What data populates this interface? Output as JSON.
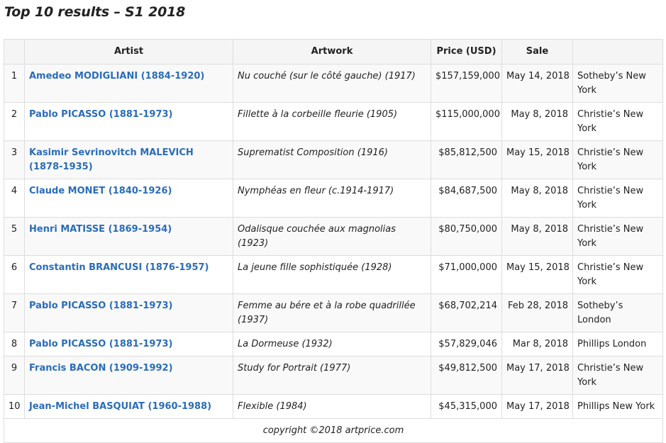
{
  "title": "Top 10 results – S1 2018",
  "table": {
    "headers": [
      "",
      "Artist",
      "Artwork",
      "Price (USD)",
      "Sale",
      ""
    ],
    "rows": [
      {
        "rank": "1",
        "artist": "Amedeo MODIGLIANI (1884-1920)",
        "artwork": "Nu couché (sur le côté gauche) (1917)",
        "price": "$157,159,000",
        "sale": "May 14, 2018",
        "house": "Sotheby’s New York"
      },
      {
        "rank": "2",
        "artist": "Pablo PICASSO (1881-1973)",
        "artwork": "Fillette à la corbeille fleurie (1905)",
        "price": "$115,000,000",
        "sale": "May 8, 2018",
        "house": "Christie’s New York"
      },
      {
        "rank": "3",
        "artist": "Kasimir Sevrinovitch MALEVICH (1878-1935)",
        "artwork": "Suprematist Composition (1916)",
        "price": "$85,812,500",
        "sale": "May 15, 2018",
        "house": "Christie’s New York"
      },
      {
        "rank": "4",
        "artist": "Claude MONET (1840-1926)",
        "artwork": "Nymphéas en fleur (c.1914-1917)",
        "price": "$84,687,500",
        "sale": "May 8, 2018",
        "house": "Christie’s New York"
      },
      {
        "rank": "5",
        "artist": "Henri MATISSE (1869-1954)",
        "artwork": "Odalisque couchée aux magnolias (1923)",
        "price": "$80,750,000",
        "sale": "May 8, 2018",
        "house": "Christie’s New York"
      },
      {
        "rank": "6",
        "artist": "Constantin BRANCUSI (1876-1957)",
        "artwork": "La jeune fille sophistiquée (1928)",
        "price": "$71,000,000",
        "sale": "May 15, 2018",
        "house": "Christie’s New York"
      },
      {
        "rank": "7",
        "artist": "Pablo PICASSO (1881-1973)",
        "artwork": "Femme au bére et à la robe quadrillée (1937)",
        "price": "$68,702,214",
        "sale": "Feb 28, 2018",
        "house": "Sotheby’s London"
      },
      {
        "rank": "8",
        "artist": "Pablo PICASSO (1881-1973)",
        "artwork": "La Dormeuse (1932)",
        "price": "$57,829,046",
        "sale": "Mar 8, 2018",
        "house": "Phillips London"
      },
      {
        "rank": "9",
        "artist": "Francis BACON (1909-1992)",
        "artwork": "Study for Portrait (1977)",
        "price": "$49,812,500",
        "sale": "May 17, 2018",
        "house": "Christie’s New York"
      },
      {
        "rank": "10",
        "artist": "Jean-Michel BASQUIAT (1960-1988)",
        "artwork": "Flexible (1984)",
        "price": "$45,315,000",
        "sale": "May 17, 2018",
        "house": "Phillips New York"
      }
    ],
    "footer": "copyright ©2018 artprice.com"
  },
  "colors": {
    "link": "#2a6db8",
    "border": "#dddddd",
    "header_bg": "#f5f5f5",
    "stripe_bg": "#f9f9f9"
  }
}
